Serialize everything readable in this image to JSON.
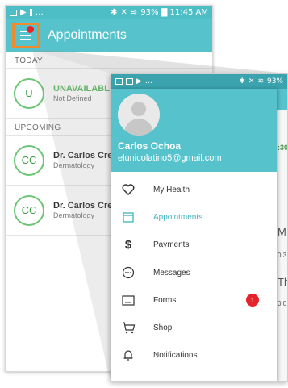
{
  "back_phone": {
    "status_bar": {
      "left": "…",
      "right": "93% ▇ 11:45 AM"
    },
    "app_bar": {
      "title": "Appointments"
    },
    "sections": [
      {
        "label": "TODAY"
      },
      {
        "label": "UPCOMING"
      }
    ],
    "appointments": [
      {
        "initials": "U",
        "title": "UNAVAILABL",
        "subtitle": "Not Defined"
      },
      {
        "initials": "CC",
        "title": "Dr. Carlos Cre",
        "subtitle": "Dermatology"
      },
      {
        "initials": "CC",
        "title": "Dr. Carlos Cre",
        "subtitle": "Dermatology"
      }
    ]
  },
  "front_phone": {
    "status_bar": {
      "left": "…",
      "right": "93%"
    },
    "profile": {
      "name": "Carlos Ochoa",
      "email": "elunicolatino5@gmail.com"
    },
    "menu": [
      {
        "label": "My Health",
        "icon": "heart-icon",
        "active": false
      },
      {
        "label": "Appointments",
        "icon": "calendar-icon",
        "active": true
      },
      {
        "label": "Payments",
        "icon": "dollar-icon",
        "active": false
      },
      {
        "label": "Messages",
        "icon": "chat-bubble-icon",
        "active": false
      },
      {
        "label": "Forms",
        "icon": "form-icon",
        "active": false,
        "badge": "1"
      },
      {
        "label": "Shop",
        "icon": "cart-icon",
        "active": false
      },
      {
        "label": "Notifications",
        "icon": "bell-icon",
        "active": false
      }
    ],
    "peek": {
      "t1": ":30",
      "t2": "M",
      "t3": "0:3",
      "t4": "Th",
      "t5": "0:0"
    }
  },
  "colors": {
    "teal": "#56c3cc",
    "accent_orange": "#f08a2c",
    "badge_red": "#e6232b",
    "green": "#6cc574"
  }
}
